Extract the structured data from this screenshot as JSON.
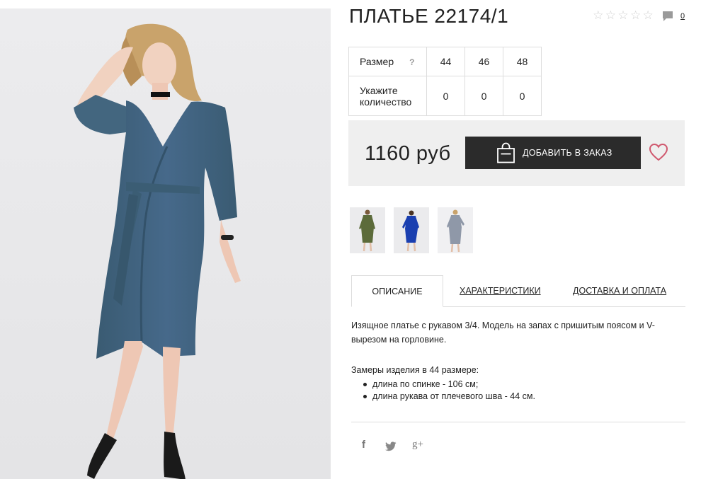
{
  "product": {
    "title": "ПЛАТЬЕ 22174/1",
    "rating_stars": [
      "☆",
      "☆",
      "☆",
      "☆",
      "☆"
    ],
    "rating_value": 0,
    "comment_count": "0"
  },
  "sizes": {
    "size_label": "Размер",
    "help_mark": "?",
    "qty_label": "Укажите количество",
    "columns": [
      "44",
      "46",
      "48"
    ],
    "quantities": [
      "0",
      "0",
      "0"
    ]
  },
  "purchase": {
    "price": "1160 руб",
    "order_button": "ДОБАВИТЬ В ЗАКАЗ",
    "wishlist_icon": "heart-icon",
    "cart_icon": "shopping-bag-icon"
  },
  "thumbnails": [
    {
      "name": "thumbnail-olive",
      "color": "#5c6b3a"
    },
    {
      "name": "thumbnail-blue",
      "color": "#1a3fb0"
    },
    {
      "name": "thumbnail-grey",
      "color": "#8f98a8"
    }
  ],
  "tabs": {
    "description": "ОПИСАНИЕ",
    "characteristics": "ХАРАКТЕРИСТИКИ",
    "delivery": "ДОСТАВКА И ОПЛАТА",
    "active": "description"
  },
  "description": {
    "text": "Изящное платье с рукавом 3/4. Модель на запах с пришитым поясом и V-вырезом на горловине.",
    "measure_title": "Замеры изделия в 44 размере:",
    "measures": [
      "длина по спинке - 106 см;",
      "длина рукава от плечевого шва - 44 см."
    ]
  },
  "social": {
    "facebook": "f",
    "twitter_icon": "twitter-icon",
    "googleplus": "g+"
  },
  "colors": {
    "dress": "#43667f",
    "button_bg": "#2b2b2b",
    "heart": "#d0586e",
    "panel_bg": "#efefef"
  }
}
